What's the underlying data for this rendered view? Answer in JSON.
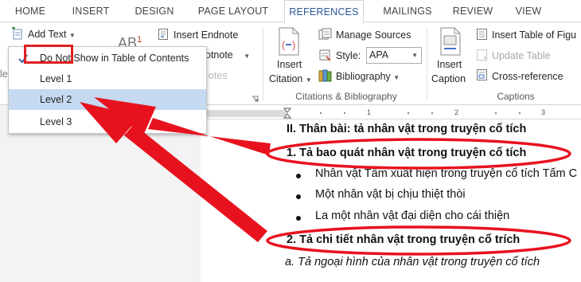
{
  "tabs": [
    {
      "label": "HOME"
    },
    {
      "label": "INSERT"
    },
    {
      "label": "DESIGN"
    },
    {
      "label": "PAGE LAYOUT"
    },
    {
      "label": "REFERENCES",
      "active": true
    },
    {
      "label": "MAILINGS"
    },
    {
      "label": "REVIEW"
    },
    {
      "label": "VIEW"
    }
  ],
  "ribbon": {
    "add_text": "Add Text",
    "insert_endnote": "Insert Endnote",
    "next_footnote_partial": "otnote",
    "show_notes_partial": "otes",
    "ab_label": "AB",
    "ab_sup": "1",
    "insert_citation_line1": "Insert",
    "insert_citation_line2": "Citation",
    "manage_sources": "Manage Sources",
    "style_label": "Style:",
    "style_value": "APA",
    "bibliography": "Bibliography",
    "insert_caption_line1": "Insert",
    "insert_caption_line2": "Caption",
    "insert_table_of_figures": "Insert Table of Figu",
    "update_table": "Update Table",
    "cross_reference": "Cross-reference",
    "left_edge_label": "le",
    "groups": {
      "citations": "Citations & Bibliography",
      "captions": "Captions"
    }
  },
  "dropdown": {
    "items": [
      {
        "label": "Do Not Show in Table of Contents",
        "checked": true
      },
      {
        "label": "Level 1"
      },
      {
        "label": "Level 2",
        "highlighted": true
      },
      {
        "label": "Level 3"
      }
    ]
  },
  "ruler": {
    "numbers": [
      "1",
      "2",
      "3"
    ]
  },
  "document": {
    "lines": [
      {
        "text": "II.  Thân bài: tả nhân vật trong truyện cổ tích",
        "style": "bold"
      },
      {
        "text": "1. Tả bao quát nhân vật trong truyện cổ tích",
        "style": "bold"
      },
      {
        "text": "Nhân vật Tấm xuất hiện trong truyện cổ tích Tấm C",
        "style": "bullet"
      },
      {
        "text": "Một nhân vật bị chịu thiệt thòi",
        "style": "bullet"
      },
      {
        "text": "La một nhân vật đại diện cho cái thiện",
        "style": "bullet"
      },
      {
        "text": "2. Tả chi tiết nhân vật trong truyện cổ trích",
        "style": "bold"
      },
      {
        "text": "a. Tả ngoại hình của nhân vật trong truyện cổ tích",
        "style": "italic"
      }
    ]
  },
  "colors": {
    "accent": "#2b579a",
    "annotation_red": "#e8121f",
    "menu_highlight": "#c5d9f1"
  }
}
